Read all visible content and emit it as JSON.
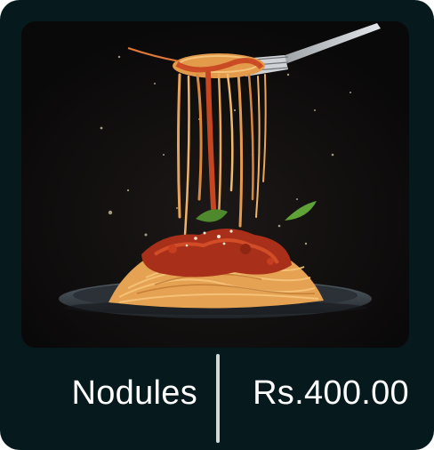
{
  "product": {
    "name": "Nodules",
    "price": "Rs.400.00"
  },
  "colors": {
    "card_background": "#061a1e",
    "photo_background": "#0c0b0c",
    "text": "#ffffff",
    "divider": "#d4d7d8"
  }
}
